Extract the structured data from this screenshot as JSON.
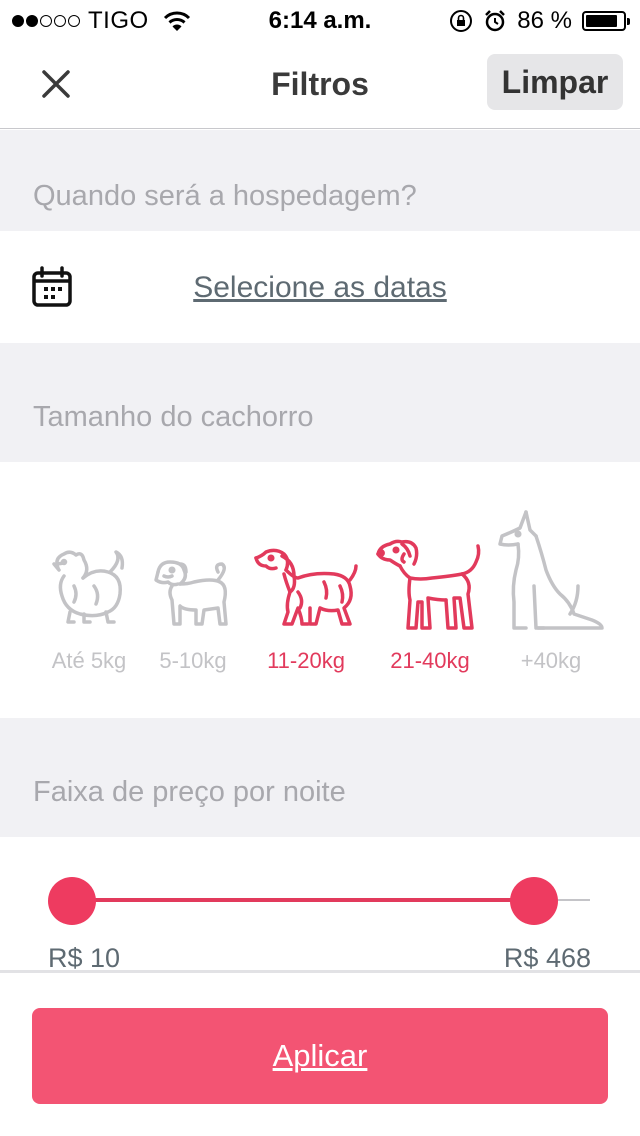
{
  "status_bar": {
    "carrier": "TIGO",
    "time": "6:14 a.m.",
    "battery": "86 %",
    "battery_level": 0.86,
    "signal_bars": 2,
    "icons": [
      "wifi-icon",
      "orientation-lock-icon",
      "alarm-icon",
      "battery-icon"
    ]
  },
  "nav": {
    "title": "Filtros",
    "clear_label": "Limpar",
    "close_icon": "close-icon"
  },
  "dates": {
    "header": "Quando será a hospedagem?",
    "link": "Selecione as datas",
    "icon": "calendar-icon"
  },
  "dog_size": {
    "header": "Tamanho do cachorro",
    "options": [
      {
        "label": "Até 5kg",
        "selected": false,
        "icon": "pomeranian-icon"
      },
      {
        "label": "5-10kg",
        "selected": false,
        "icon": "pug-icon"
      },
      {
        "label": "11-20kg",
        "selected": true,
        "icon": "spaniel-icon"
      },
      {
        "label": "21-40kg",
        "selected": true,
        "icon": "retriever-icon"
      },
      {
        "label": "+40kg",
        "selected": false,
        "icon": "great-dane-icon"
      }
    ]
  },
  "price": {
    "header": "Faixa de preço por noite",
    "min_label": "R$ 10",
    "max_label": "R$ 468"
  },
  "apply_label": "Aplicar",
  "colors": {
    "accent": "#e23a5c",
    "button": "#f35473",
    "section_bg": "#f1f1f4",
    "muted_text": "#a8a8ad",
    "inactive_icon": "#c3c3c6"
  }
}
